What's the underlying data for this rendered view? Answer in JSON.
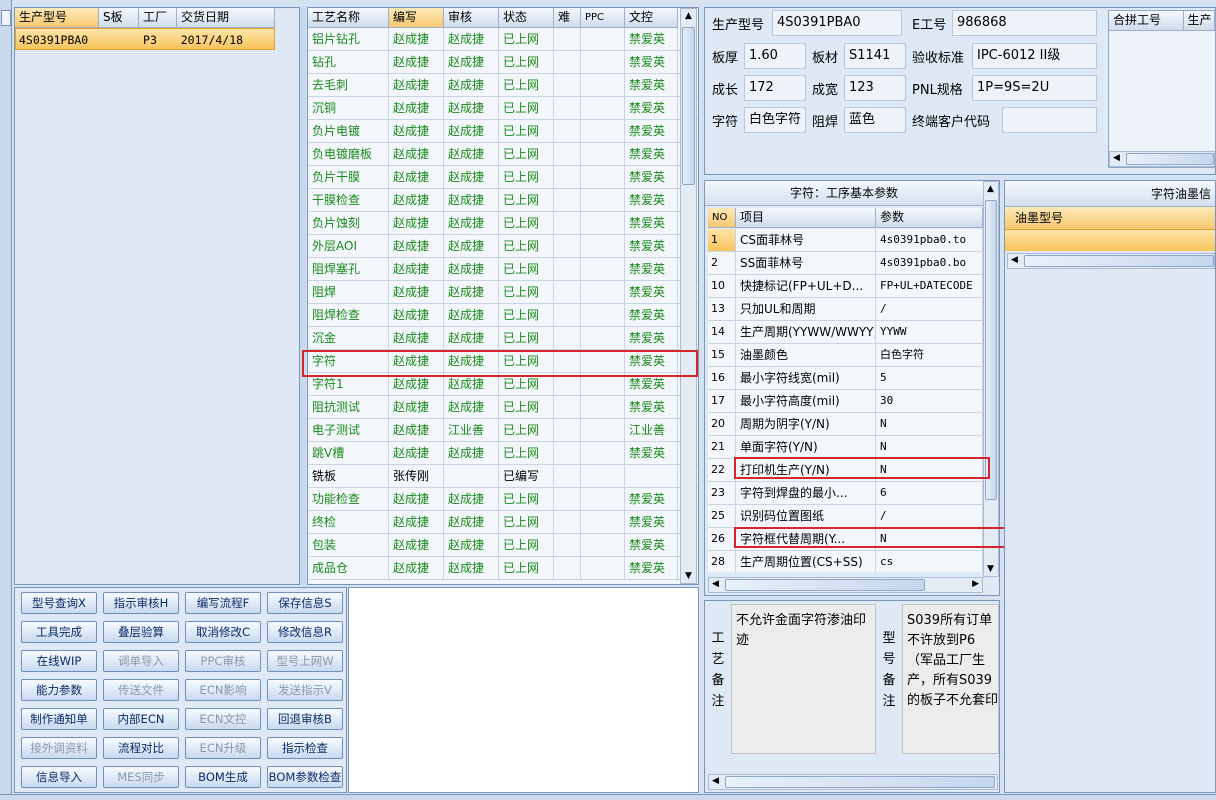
{
  "left_grid": {
    "headers": [
      "生产型号",
      "S板",
      "工厂",
      "交货日期"
    ],
    "rows": [
      [
        "4S0391PBA0",
        "",
        "P3",
        "2017/4/18"
      ]
    ]
  },
  "process_grid": {
    "headers": [
      "工艺名称",
      "编写",
      "审核",
      "状态",
      "难",
      "PPC",
      "文控"
    ],
    "rows": [
      [
        "铝片钻孔",
        "赵成捷",
        "赵成捷",
        "已上网",
        "",
        "",
        "禁爱英"
      ],
      [
        "钻孔",
        "赵成捷",
        "赵成捷",
        "已上网",
        "",
        "",
        "禁爱英"
      ],
      [
        "去毛刺",
        "赵成捷",
        "赵成捷",
        "已上网",
        "",
        "",
        "禁爱英"
      ],
      [
        "沉铜",
        "赵成捷",
        "赵成捷",
        "已上网",
        "",
        "",
        "禁爱英"
      ],
      [
        "负片电镀",
        "赵成捷",
        "赵成捷",
        "已上网",
        "",
        "",
        "禁爱英"
      ],
      [
        "负电镀磨板",
        "赵成捷",
        "赵成捷",
        "已上网",
        "",
        "",
        "禁爱英"
      ],
      [
        "负片干膜",
        "赵成捷",
        "赵成捷",
        "已上网",
        "",
        "",
        "禁爱英"
      ],
      [
        "干膜检查",
        "赵成捷",
        "赵成捷",
        "已上网",
        "",
        "",
        "禁爱英"
      ],
      [
        "负片蚀刻",
        "赵成捷",
        "赵成捷",
        "已上网",
        "",
        "",
        "禁爱英"
      ],
      [
        "外层AOI",
        "赵成捷",
        "赵成捷",
        "已上网",
        "",
        "",
        "禁爱英"
      ],
      [
        "阻焊塞孔",
        "赵成捷",
        "赵成捷",
        "已上网",
        "",
        "",
        "禁爱英"
      ],
      [
        "阻焊",
        "赵成捷",
        "赵成捷",
        "已上网",
        "",
        "",
        "禁爱英"
      ],
      [
        "阻焊检查",
        "赵成捷",
        "赵成捷",
        "已上网",
        "",
        "",
        "禁爱英"
      ],
      [
        "沉金",
        "赵成捷",
        "赵成捷",
        "已上网",
        "",
        "",
        "禁爱英"
      ],
      [
        "字符",
        "赵成捷",
        "赵成捷",
        "已上网",
        "",
        "",
        "禁爱英"
      ],
      [
        "字符1",
        "赵成捷",
        "赵成捷",
        "已上网",
        "",
        "",
        "禁爱英"
      ],
      [
        "阻抗测试",
        "赵成捷",
        "赵成捷",
        "已上网",
        "",
        "",
        "禁爱英"
      ],
      [
        "电子测试",
        "赵成捷",
        "江业善",
        "已上网",
        "",
        "",
        "江业善"
      ],
      [
        "跳V槽",
        "赵成捷",
        "赵成捷",
        "已上网",
        "",
        "",
        "禁爱英"
      ],
      [
        "铣板",
        "张传刚",
        "",
        "已编写",
        "",
        "",
        ""
      ],
      [
        "功能检查",
        "赵成捷",
        "赵成捷",
        "已上网",
        "",
        "",
        "禁爱英"
      ],
      [
        "终检",
        "赵成捷",
        "赵成捷",
        "已上网",
        "",
        "",
        "禁爱英"
      ],
      [
        "包装",
        "赵成捷",
        "赵成捷",
        "已上网",
        "",
        "",
        "禁爱英"
      ],
      [
        "成品仓",
        "赵成捷",
        "赵成捷",
        "已上网",
        "",
        "",
        "禁爱英"
      ]
    ]
  },
  "buttons": [
    [
      "型号查询X",
      "指示审核H",
      "编写流程F",
      "保存信息S"
    ],
    [
      "工具完成",
      "叠层验算",
      "取消修改C",
      "修改信息R"
    ],
    [
      "在线WIP",
      "调单导入",
      "PPC审核",
      "型号上网W"
    ],
    [
      "能力参数",
      "传送文件",
      "ECN影响",
      "发送指示V"
    ],
    [
      "制作通知单",
      "内部ECN",
      "ECN文控",
      "回退审核B"
    ],
    [
      "接外调资料",
      "流程对比",
      "ECN升级",
      "指示检查"
    ],
    [
      "信息导入",
      "MES同步",
      "BOM生成",
      "BOM参数检查"
    ]
  ],
  "buttons_disabled": [
    [
      false,
      false,
      false,
      false
    ],
    [
      false,
      false,
      false,
      false
    ],
    [
      false,
      true,
      true,
      true
    ],
    [
      false,
      true,
      true,
      true
    ],
    [
      false,
      false,
      true,
      false
    ],
    [
      true,
      false,
      true,
      false
    ],
    [
      false,
      true,
      false,
      false
    ]
  ],
  "info": {
    "model_label": "生产型号",
    "model_value": "4S0391PBA0",
    "e_label": "E工号",
    "e_value": "986868",
    "thickness_label": "板厚",
    "thickness_value": "1.60",
    "material_label": "板材",
    "material_value": "S1141",
    "standard_label": "验收标准",
    "standard_value": "IPC-6012 II级",
    "length_label": "成长",
    "length_value": "172",
    "width_label": "成宽",
    "width_value": "123",
    "pnl_label": "PNL规格",
    "pnl_value": "1P=9S=2U",
    "char_label": "字符",
    "char_value": "白色字符",
    "mask_label": "阻焊",
    "mask_value": "蓝色",
    "customer_label": "终端客户代码",
    "customer_value": ""
  },
  "merge_grid": {
    "headers": [
      "合拼工号",
      "生产"
    ]
  },
  "params": {
    "title": "字符：工序基本参数",
    "headers": [
      "NO",
      "项目",
      "参数"
    ],
    "rows": [
      [
        "1",
        "CS面菲林号",
        "4s0391pba0.to"
      ],
      [
        "2",
        "SS面菲林号",
        "4s0391pba0.bo"
      ],
      [
        "10",
        "快捷标记(FP+UL+D...",
        "FP+UL+DATECODE"
      ],
      [
        "13",
        "只加UL和周期",
        "/"
      ],
      [
        "14",
        "生产周期(YYWW/WWYY)",
        "YYWW"
      ],
      [
        "15",
        "油墨颜色",
        "白色字符"
      ],
      [
        "16",
        "最小字符线宽(mil)",
        "5"
      ],
      [
        "17",
        "最小字符高度(mil)",
        "30"
      ],
      [
        "20",
        "周期为阴字(Y/N)",
        "N"
      ],
      [
        "21",
        "单面字符(Y/N)",
        "N"
      ],
      [
        "22",
        "打印机生产(Y/N)",
        "N"
      ],
      [
        "23",
        "字符到焊盘的最小...",
        "6"
      ],
      [
        "25",
        "识别码位置图纸",
        "/"
      ],
      [
        "26",
        "字符框代替周期(Y...",
        "N"
      ],
      [
        "28",
        "生产周期位置(CS+SS)",
        "cs"
      ]
    ]
  },
  "ink": {
    "title": "字符油墨信",
    "header": "油墨型号"
  },
  "notes": {
    "process_label": "工艺备注",
    "process_text": "不允许金面字符渗油印迹",
    "model_label": "型号备注",
    "model_text": "S039所有订单不许放到P6（军品工厂生产，所有S039的板子不允套印"
  }
}
